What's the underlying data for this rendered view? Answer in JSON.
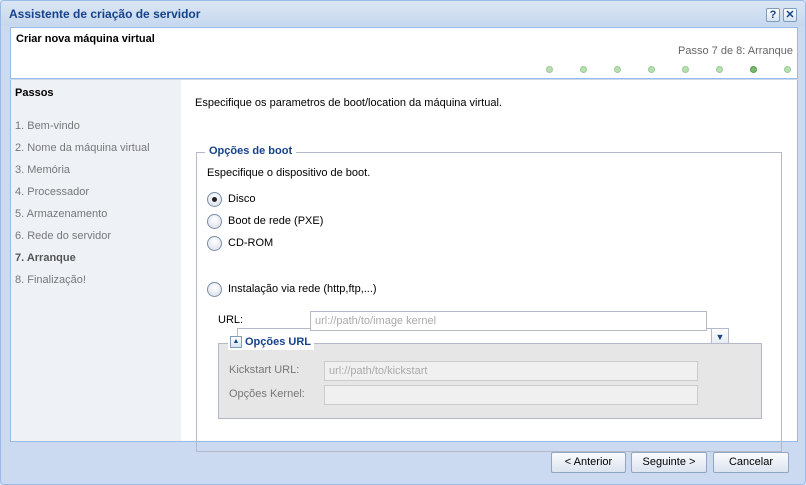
{
  "window": {
    "title": "Assistente de criação de servidor",
    "help_icon": "?",
    "close_icon": "✕"
  },
  "header": {
    "title": "Criar nova máquina virtual",
    "step_text": "Passo 7 de 8: Arranque",
    "total_steps": 8,
    "current_step": 7
  },
  "sidebar": {
    "title": "Passos",
    "steps": [
      "1. Bem-vindo",
      "2. Nome da máquina virtual",
      "3. Memória",
      "4. Processador",
      "5. Armazenamento",
      "6. Rede do servidor",
      "7. Arranque",
      "8. Finalização!"
    ]
  },
  "content": {
    "intro": "Especifique os parametros de boot/location da máquina virtual.",
    "boot_options": {
      "legend": "Opções de boot",
      "description": "Especifique o dispositivo de boot.",
      "options": [
        "Disco",
        "Boot de rede (PXE)",
        "CD-ROM",
        "Instalação via rede (http,ftp,...)"
      ],
      "selected": "Disco",
      "cdrom_value": "",
      "url_label": "URL:",
      "url_placeholder": "url://path/to/image kernel"
    },
    "url_options": {
      "legend": "Opções URL",
      "kickstart_label": "Kickstart URL:",
      "kickstart_placeholder": "url://path/to/kickstart",
      "kernel_label": "Opções Kernel:",
      "kernel_value": ""
    }
  },
  "footer": {
    "prev_label": "< Anterior",
    "next_label": "Seguinte >",
    "cancel_label": "Cancelar"
  },
  "colors": {
    "accent": "#15428b",
    "border": "#99bbe8",
    "dot": "#b8e0b0",
    "dot_active": "#7ab96e"
  }
}
